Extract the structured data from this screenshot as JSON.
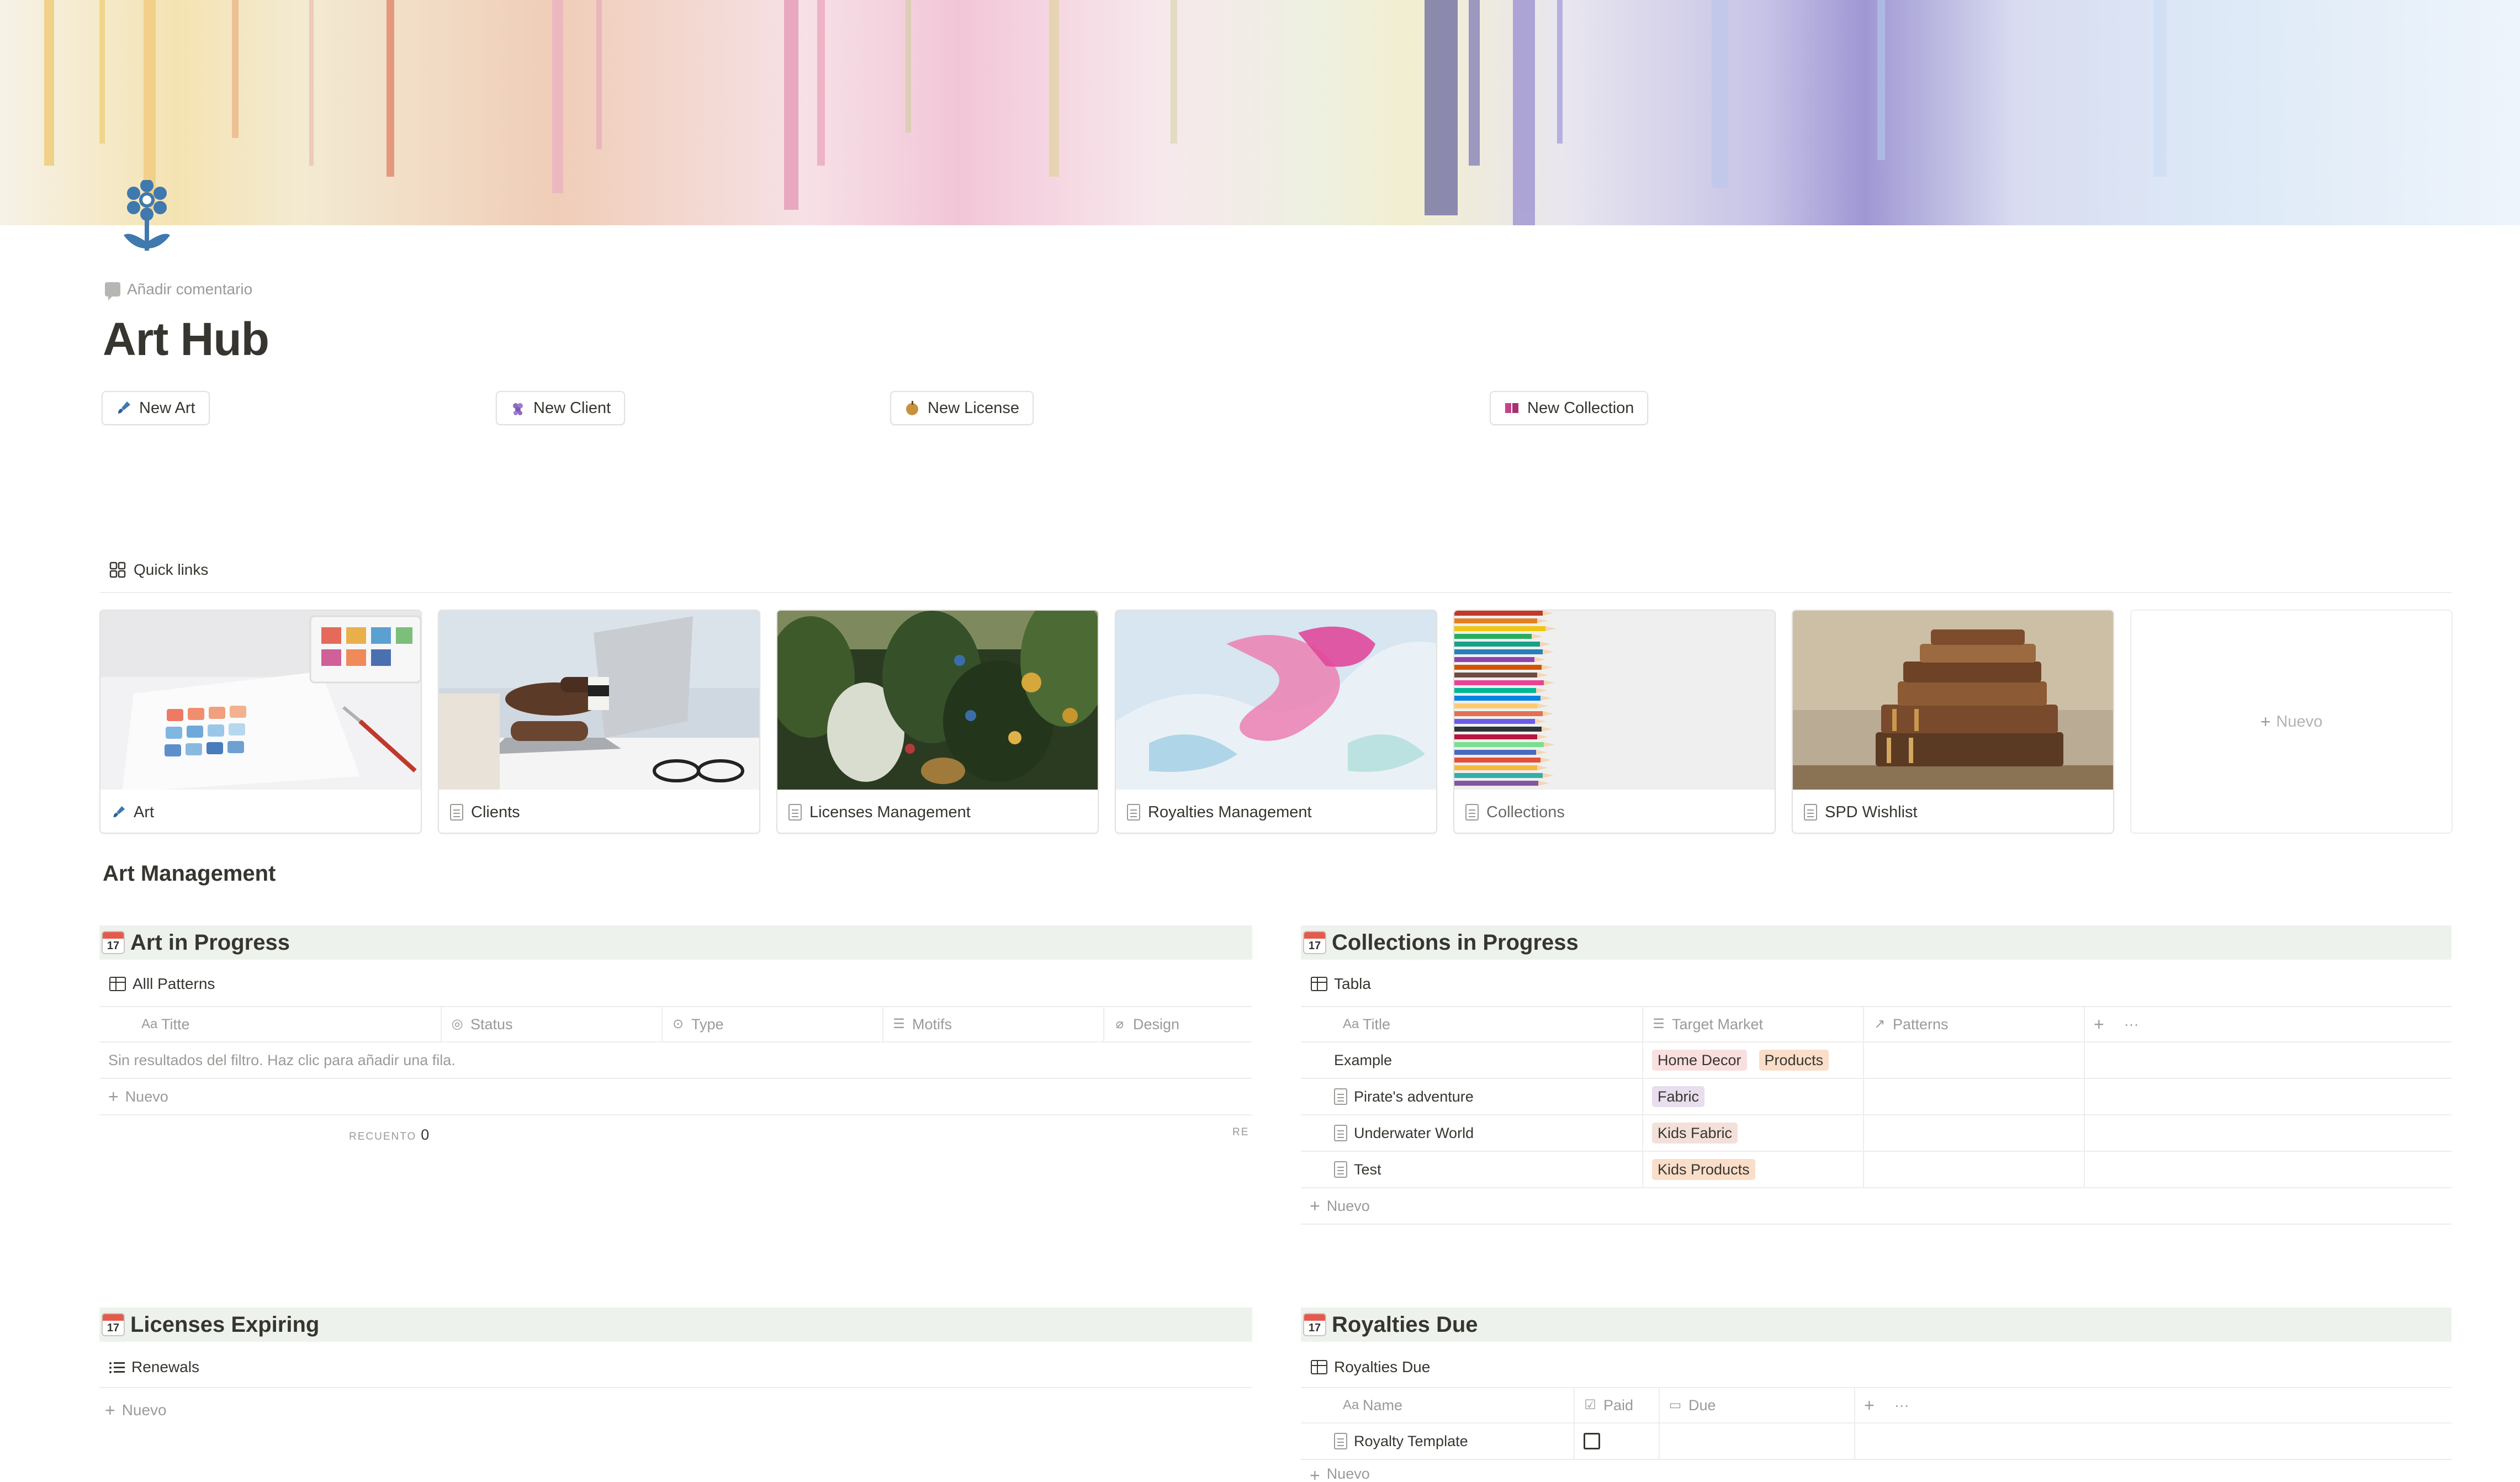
{
  "page": {
    "title": "Art Hub",
    "add_comment": "Añadir comentario"
  },
  "buttons": [
    {
      "label": "New Art",
      "icon": "paintbrush-icon"
    },
    {
      "label": "New Client",
      "icon": "grapes-icon"
    },
    {
      "label": "New License",
      "icon": "apple-icon"
    },
    {
      "label": "New Collection",
      "icon": "book-icon"
    }
  ],
  "quick_links": {
    "title": "Quick links",
    "cards": [
      {
        "label": "Art",
        "icon": "paintbrush-icon"
      },
      {
        "label": "Clients",
        "icon": "page-icon"
      },
      {
        "label": "Licenses Management",
        "icon": "page-icon"
      },
      {
        "label": "Royalties Management",
        "icon": "page-icon"
      },
      {
        "label": "Collections",
        "icon": "page-icon"
      },
      {
        "label": "SPD Wishlist",
        "icon": "page-icon"
      }
    ],
    "new_label": "Nuevo"
  },
  "art_management": {
    "title": "Art Management"
  },
  "art_in_progress": {
    "title": "Art in Progress",
    "view": "Alll Patterns",
    "columns": [
      "Titte",
      "Status",
      "Type",
      "Motifs",
      "Design"
    ],
    "empty_message": "Sin resultados del filtro. Haz clic para añadir una fila.",
    "new_label": "Nuevo",
    "count_label": "RECUENTO",
    "count_value": "0",
    "count_label_truncated": "RE"
  },
  "collections_in_progress": {
    "title": "Collections in Progress",
    "view": "Tabla",
    "columns": [
      "Title",
      "Target Market",
      "Patterns"
    ],
    "rows": [
      {
        "title": "Example",
        "tags": [
          "Home Decor",
          "Products"
        ],
        "has_icon": false
      },
      {
        "title": "Pirate's adventure",
        "tags": [
          "Fabric"
        ],
        "has_icon": true
      },
      {
        "title": "Underwater World",
        "tags": [
          "Kids Fabric"
        ],
        "has_icon": true
      },
      {
        "title": "Test",
        "tags": [
          "Kids Products"
        ],
        "has_icon": true
      }
    ],
    "new_label": "Nuevo",
    "add_column": "+",
    "more": "···"
  },
  "licenses_expiring": {
    "title": "Licenses Expiring",
    "view": "Renewals",
    "new_label": "Nuevo"
  },
  "royalties_due": {
    "title": "Royalties Due",
    "view": "Royalties Due",
    "columns": [
      "Name",
      "Paid",
      "Due"
    ],
    "rows": [
      {
        "name": "Royalty Template",
        "paid": false
      }
    ],
    "new_label": "Nuevo",
    "add_column": "+",
    "more": "···"
  },
  "calendar_icon_text": "17",
  "colors": {
    "block_header_bg": "#edf3ec",
    "tag_home_decor": "#f9dfe0",
    "tag_products": "#fadec9",
    "tag_fabric": "#e8deee",
    "tag_kids_fabric": "#f3e0d9",
    "tag_kids_products": "#fadec9",
    "flower_icon": "#3f79ad"
  }
}
